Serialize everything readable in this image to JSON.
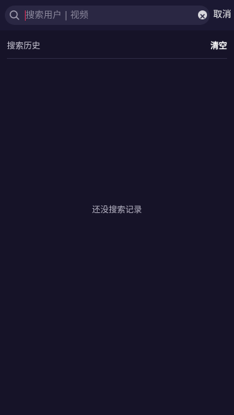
{
  "search": {
    "placeholder": "搜索用户 | 视频",
    "value": "",
    "cancel_label": "取消"
  },
  "history": {
    "title": "搜索历史",
    "clear_label": "清空",
    "empty_text": "还没搜索记录"
  },
  "icons": {
    "search": "search-icon",
    "clear": "clear-icon"
  },
  "colors": {
    "background": "#161328",
    "search_box": "#2a2743",
    "caret": "#e0305a"
  }
}
